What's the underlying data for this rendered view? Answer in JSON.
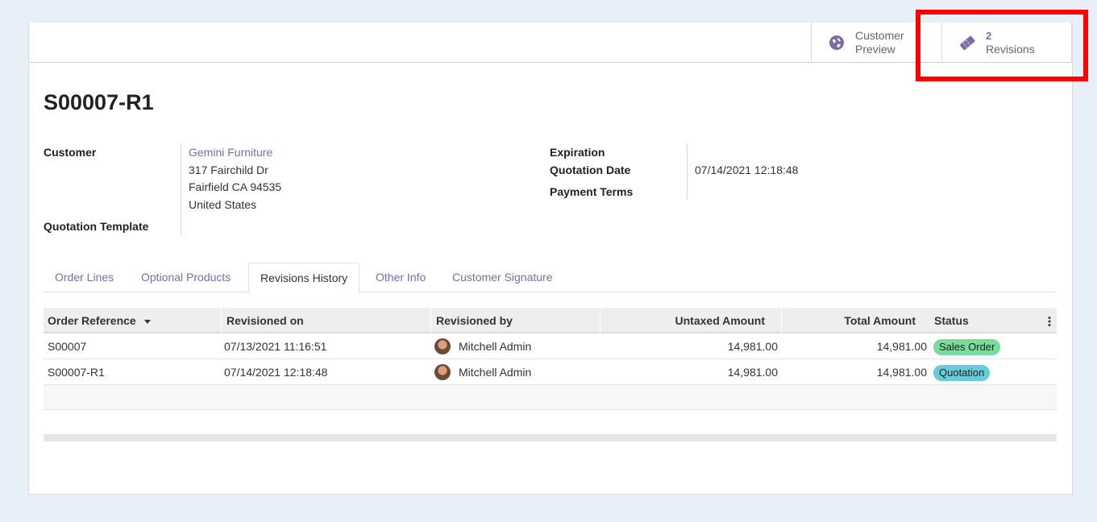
{
  "smart_buttons": {
    "preview": {
      "line1": "Customer",
      "line2": "Preview"
    },
    "revisions": {
      "count": "2",
      "label": "Revisions"
    }
  },
  "record": {
    "name": "S00007-R1"
  },
  "fields": {
    "customer_label": "Customer",
    "customer_name": "Gemini Furniture",
    "address_line1": "317 Fairchild Dr",
    "address_line2": "Fairfield CA 94535",
    "address_line3": "United States",
    "template_label": "Quotation Template",
    "expiration_label": "Expiration",
    "quotation_date_label": "Quotation Date",
    "quotation_date_value": "07/14/2021 12:18:48",
    "payment_terms_label": "Payment Terms"
  },
  "tabs": [
    {
      "label": "Order Lines"
    },
    {
      "label": "Optional Products"
    },
    {
      "label": "Revisions History"
    },
    {
      "label": "Other Info"
    },
    {
      "label": "Customer Signature"
    }
  ],
  "table": {
    "headers": {
      "order_ref": "Order Reference",
      "revisioned_on": "Revisioned on",
      "revisioned_by": "Revisioned by",
      "untaxed": "Untaxed Amount",
      "total": "Total Amount",
      "status": "Status"
    },
    "rows": [
      {
        "ref": "S00007",
        "on": "07/13/2021 11:16:51",
        "by": "Mitchell Admin",
        "untaxed": "14,981.00",
        "total": "14,981.00",
        "status": "Sales Order"
      },
      {
        "ref": "S00007-R1",
        "on": "07/14/2021 12:18:48",
        "by": "Mitchell Admin",
        "untaxed": "14,981.00",
        "total": "14,981.00",
        "status": "Quotation"
      }
    ]
  },
  "colors": {
    "accent": "#7c6ca4",
    "badge_sales_order": "#77dd99",
    "badge_quotation": "#66ccd9",
    "highlight": "#ff0000"
  },
  "icons": {
    "preview": "globe-icon",
    "revisions": "ticket-icon",
    "sort": "caret-down-icon",
    "column_options": "kebab-icon"
  }
}
